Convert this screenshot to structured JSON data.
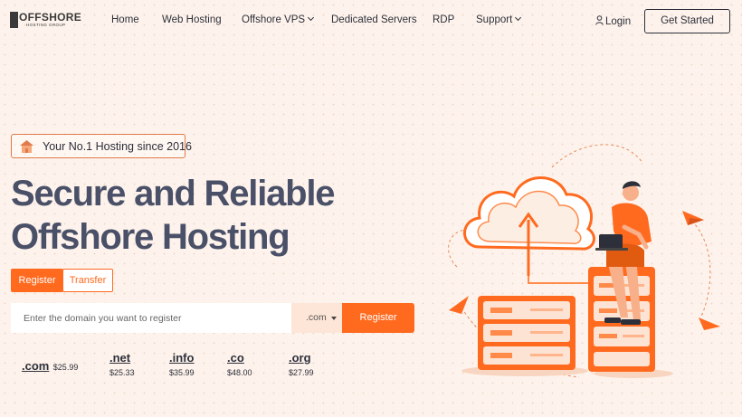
{
  "brand": {
    "logo_text": "OFFSHORE",
    "logo_tag": "HOSTING GROUP"
  },
  "nav": {
    "items": [
      "Home",
      "Web Hosting",
      "Offshore VPS",
      "Dedicated Servers",
      "RDP",
      "Support"
    ],
    "login": "Login",
    "get_started": "Get Started"
  },
  "hero": {
    "badge": "Your No.1 Hosting since 2016",
    "title_line1": "Secure and Reliable",
    "title_line2": "Offshore Hosting"
  },
  "domain_search": {
    "tabs": [
      "Register",
      "Transfer"
    ],
    "active_tab": "Register",
    "placeholder": "Enter the domain you want to register",
    "selected_tld": ".com",
    "button": "Register"
  },
  "tld_prices": [
    {
      "tld": ".com",
      "price": "$25.99"
    },
    {
      "tld": ".net",
      "price": "$25.33"
    },
    {
      "tld": ".info",
      "price": "$35.99"
    },
    {
      "tld": ".co",
      "price": "$48.00"
    },
    {
      "tld": ".org",
      "price": "$27.99"
    }
  ],
  "colors": {
    "accent": "#ff6a1f",
    "background": "#fdf3ec",
    "title": "#4a5068",
    "text": "#2d2f3a"
  },
  "icons": [
    "user-icon",
    "house-box-icon",
    "chevron-down-icon",
    "cloud-upload-icon",
    "server-icon",
    "paper-plane-icon"
  ]
}
